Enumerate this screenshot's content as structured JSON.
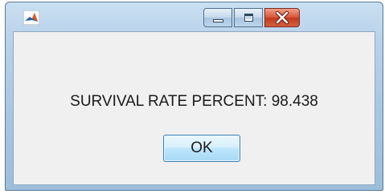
{
  "window": {
    "app_icon": "matlab-icon",
    "buttons": {
      "minimize_icon": "minimize-icon",
      "maximize_icon": "maximize-icon",
      "close_icon": "close-icon"
    },
    "colors": {
      "close_button": "#c9432a",
      "frame": "#a7c6e2",
      "client_background": "#f0f0f0"
    }
  },
  "dialog": {
    "message": "SURVIVAL RATE PERCENT: 98.438",
    "ok_label": "OK"
  }
}
